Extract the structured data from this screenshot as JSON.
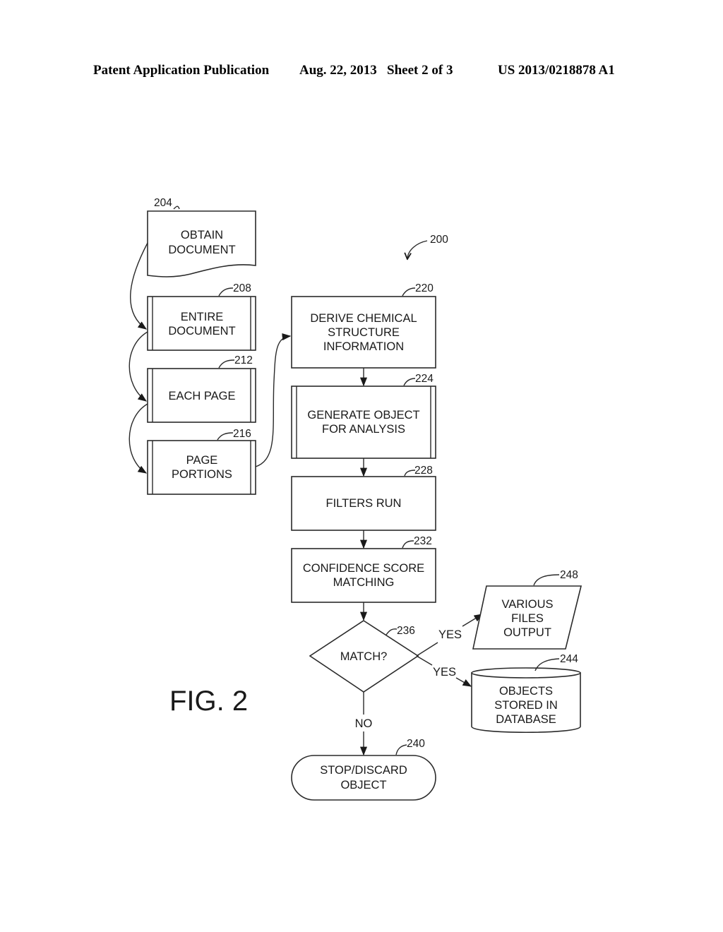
{
  "header": {
    "publication_type": "Patent Application Publication",
    "date_sheet": "Aug. 22, 2013   Sheet 2 of 3",
    "patent_number": "US 2013/0218878 A1"
  },
  "figure": {
    "label": "FIG. 2",
    "reference": "200"
  },
  "nodes": {
    "n204": {
      "ref": "204",
      "shape": "document",
      "lines": [
        "OBTAIN",
        "DOCUMENT"
      ]
    },
    "n208": {
      "ref": "208",
      "shape": "predefined-process",
      "lines": [
        "ENTIRE",
        "DOCUMENT"
      ]
    },
    "n212": {
      "ref": "212",
      "shape": "predefined-process",
      "lines": [
        "EACH PAGE"
      ]
    },
    "n216": {
      "ref": "216",
      "shape": "predefined-process",
      "lines": [
        "PAGE",
        "PORTIONS"
      ]
    },
    "n220": {
      "ref": "220",
      "shape": "process",
      "lines": [
        "DERIVE CHEMICAL",
        "STRUCTURE",
        "INFORMATION"
      ]
    },
    "n224": {
      "ref": "224",
      "shape": "predefined-process",
      "lines": [
        "GENERATE OBJECT",
        "FOR ANALYSIS"
      ]
    },
    "n228": {
      "ref": "228",
      "shape": "process",
      "lines": [
        "FILTERS RUN"
      ]
    },
    "n232": {
      "ref": "232",
      "shape": "process",
      "lines": [
        "CONFIDENCE SCORE",
        "MATCHING"
      ]
    },
    "n236": {
      "ref": "236",
      "shape": "decision",
      "lines": [
        "MATCH?"
      ]
    },
    "n240": {
      "ref": "240",
      "shape": "terminator",
      "lines": [
        "STOP/DISCARD",
        "OBJECT"
      ]
    },
    "n244": {
      "ref": "244",
      "shape": "database",
      "lines": [
        "OBJECTS",
        "STORED IN",
        "DATABASE"
      ]
    },
    "n248": {
      "ref": "248",
      "shape": "data-io",
      "lines": [
        "VARIOUS",
        "FILES",
        "OUTPUT"
      ]
    }
  },
  "edges": {
    "yes_to_files": "YES",
    "yes_to_database": "YES",
    "no_to_stop": "NO"
  }
}
